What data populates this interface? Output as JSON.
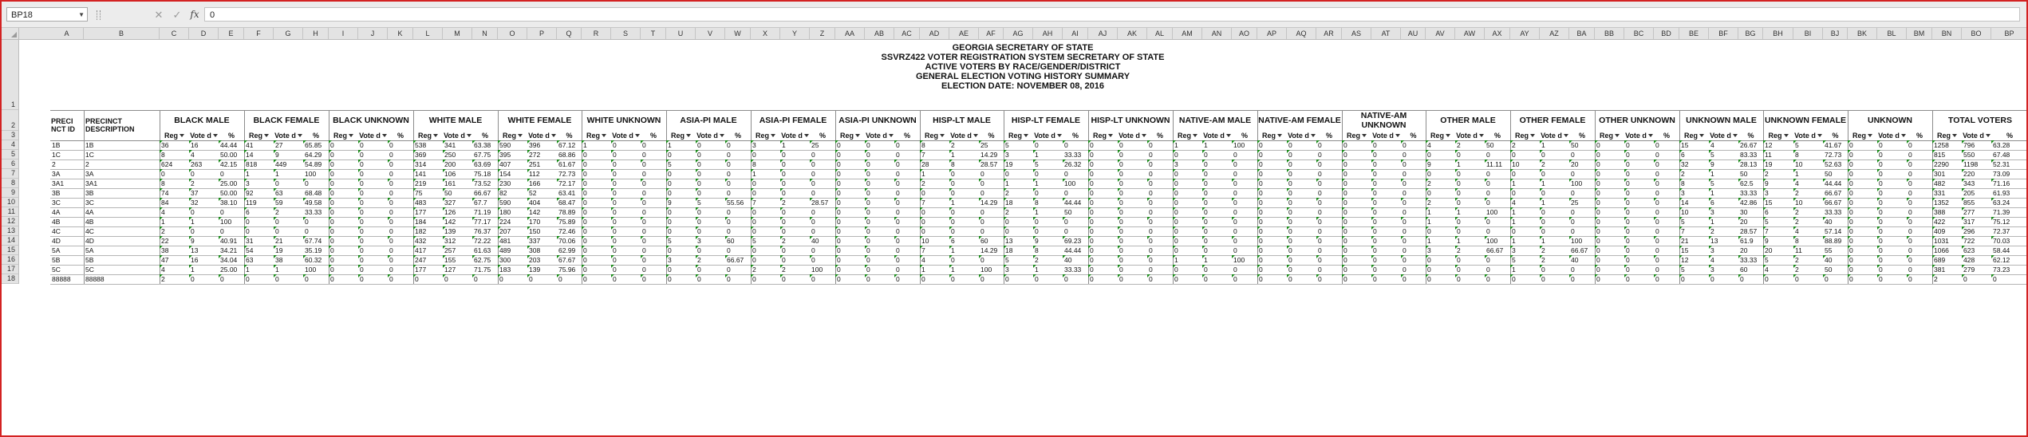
{
  "formula_bar": {
    "name_box": "BP18",
    "cancel_icon": "close-icon",
    "enter_icon": "check-icon",
    "fx_label": "fx",
    "value": "0"
  },
  "columns": [
    "A",
    "B",
    "C",
    "D",
    "E",
    "F",
    "G",
    "H",
    "I",
    "J",
    "K",
    "L",
    "M",
    "N",
    "O",
    "P",
    "Q",
    "R",
    "S",
    "T",
    "U",
    "V",
    "W",
    "X",
    "Y",
    "Z",
    "AA",
    "AB",
    "AC",
    "AD",
    "AE",
    "AF",
    "AG",
    "AH",
    "AI",
    "AJ",
    "AK",
    "AL",
    "AM",
    "AN",
    "AO",
    "AP",
    "AQ",
    "AR",
    "AS",
    "AT",
    "AU",
    "AV",
    "AW",
    "AX",
    "AY",
    "AZ",
    "BA",
    "BB",
    "BC",
    "BD",
    "BE",
    "BF",
    "BG",
    "BH",
    "BI",
    "BJ",
    "BK",
    "BL",
    "BM",
    "BN",
    "BO",
    "BP"
  ],
  "rows": [
    "1",
    "2",
    "3",
    "4",
    "5",
    "6",
    "7",
    "8",
    "9",
    "10",
    "11",
    "12",
    "13",
    "14",
    "15",
    "16",
    "17",
    "18"
  ],
  "report_title": [
    "GEORGIA SECRETARY OF STATE",
    "SSVRZ422 VOTER REGISTRATION SYSTEM SECRETARY OF STATE",
    "ACTIVE VOTERS BY RACE/GENDER/DISTRICT",
    "GENERAL ELECTION VOTING HISTORY SUMMARY",
    "ELECTION DATE: NOVEMBER 08, 2016"
  ],
  "header": {
    "precinct_id": "PRECI NCT ID",
    "precinct_desc": "PRECINCT DESCRIPTION",
    "groups": [
      "BLACK MALE",
      "BLACK FEMALE",
      "BLACK UNKNOWN",
      "WHITE MALE",
      "WHITE FEMALE",
      "WHITE UNKNOWN",
      "ASIA-PI MALE",
      "ASIA-PI FEMALE",
      "ASIA-PI UNKNOWN",
      "HISP-LT MALE",
      "HISP-LT FEMALE",
      "HISP-LT UNKNOWN",
      "NATIVE-AM MALE",
      "NATIVE-AM FEMALE",
      "NATIVE-AM UNKNOWN",
      "OTHER MALE",
      "OTHER FEMALE",
      "OTHER UNKNOWN",
      "UNKNOWN MALE",
      "UNKNOWN FEMALE",
      "UNKNOWN",
      "TOTAL VOTERS"
    ],
    "sub": [
      "Reg",
      "Vote d",
      "%"
    ]
  },
  "data_rows": [
    {
      "id": "1B",
      "desc": "1B",
      "v": [
        "36",
        "16",
        "44.44",
        "41",
        "27",
        "65.85",
        "0",
        "0",
        "0",
        "538",
        "341",
        "63.38",
        "590",
        "396",
        "67.12",
        "1",
        "0",
        "0",
        "1",
        "0",
        "0",
        "3",
        "1",
        "25",
        "0",
        "0",
        "0",
        "8",
        "2",
        "25",
        "5",
        "0",
        "0",
        "0",
        "0",
        "0",
        "1",
        "1",
        "100",
        "0",
        "0",
        "0",
        "0",
        "0",
        "0",
        "4",
        "2",
        "50",
        "2",
        "1",
        "50",
        "0",
        "0",
        "0",
        "15",
        "4",
        "26.67",
        "12",
        "5",
        "41.67",
        "0",
        "0",
        "0",
        "1258",
        "796",
        "63.28"
      ]
    },
    {
      "id": "1C",
      "desc": "1C",
      "v": [
        "8",
        "4",
        "50.00",
        "14",
        "9",
        "64.29",
        "0",
        "0",
        "0",
        "369",
        "250",
        "67.75",
        "395",
        "272",
        "68.86",
        "0",
        "0",
        "0",
        "0",
        "0",
        "0",
        "0",
        "0",
        "0",
        "0",
        "0",
        "0",
        "7",
        "1",
        "14.29",
        "3",
        "1",
        "33.33",
        "0",
        "0",
        "0",
        "0",
        "0",
        "0",
        "0",
        "0",
        "0",
        "0",
        "0",
        "0",
        "0",
        "0",
        "0",
        "0",
        "0",
        "0",
        "0",
        "0",
        "0",
        "6",
        "5",
        "83.33",
        "11",
        "8",
        "72.73",
        "0",
        "0",
        "0",
        "815",
        "550",
        "67.48"
      ]
    },
    {
      "id": "2",
      "desc": "2",
      "v": [
        "624",
        "263",
        "42.15",
        "818",
        "449",
        "54.89",
        "0",
        "0",
        "0",
        "314",
        "200",
        "63.69",
        "407",
        "251",
        "61.67",
        "0",
        "0",
        "0",
        "5",
        "0",
        "0",
        "8",
        "0",
        "0",
        "0",
        "0",
        "0",
        "28",
        "8",
        "28.57",
        "19",
        "5",
        "26.32",
        "0",
        "0",
        "0",
        "3",
        "0",
        "0",
        "0",
        "0",
        "0",
        "0",
        "0",
        "0",
        "9",
        "1",
        "11.11",
        "10",
        "2",
        "20",
        "0",
        "0",
        "0",
        "32",
        "9",
        "28.13",
        "19",
        "10",
        "52.63",
        "0",
        "0",
        "0",
        "2290",
        "1198",
        "52.31"
      ]
    },
    {
      "id": "3A",
      "desc": "3A",
      "v": [
        "0",
        "0",
        "0",
        "1",
        "1",
        "100",
        "0",
        "0",
        "0",
        "141",
        "106",
        "75.18",
        "154",
        "112",
        "72.73",
        "0",
        "0",
        "0",
        "0",
        "0",
        "0",
        "1",
        "0",
        "0",
        "0",
        "0",
        "0",
        "1",
        "0",
        "0",
        "0",
        "0",
        "0",
        "0",
        "0",
        "0",
        "0",
        "0",
        "0",
        "0",
        "0",
        "0",
        "0",
        "0",
        "0",
        "0",
        "0",
        "0",
        "0",
        "0",
        "0",
        "0",
        "0",
        "0",
        "2",
        "1",
        "50",
        "2",
        "1",
        "50",
        "0",
        "0",
        "0",
        "301",
        "220",
        "73.09"
      ]
    },
    {
      "id": "3A1",
      "desc": "3A1",
      "v": [
        "8",
        "2",
        "25.00",
        "3",
        "0",
        "0",
        "0",
        "0",
        "0",
        "219",
        "161",
        "73.52",
        "230",
        "166",
        "72.17",
        "0",
        "0",
        "0",
        "0",
        "0",
        "0",
        "0",
        "0",
        "0",
        "0",
        "0",
        "0",
        "2",
        "0",
        "0",
        "1",
        "1",
        "100",
        "0",
        "0",
        "0",
        "0",
        "0",
        "0",
        "0",
        "0",
        "0",
        "0",
        "0",
        "0",
        "2",
        "0",
        "0",
        "1",
        "1",
        "100",
        "0",
        "0",
        "0",
        "8",
        "5",
        "62.5",
        "9",
        "4",
        "44.44",
        "0",
        "0",
        "0",
        "482",
        "343",
        "71.16"
      ]
    },
    {
      "id": "3B",
      "desc": "3B",
      "v": [
        "74",
        "37",
        "50.00",
        "92",
        "63",
        "68.48",
        "0",
        "0",
        "0",
        "75",
        "50",
        "66.67",
        "82",
        "52",
        "63.41",
        "0",
        "0",
        "0",
        "0",
        "0",
        "0",
        "0",
        "0",
        "0",
        "0",
        "0",
        "0",
        "0",
        "0",
        "0",
        "2",
        "0",
        "0",
        "0",
        "0",
        "0",
        "0",
        "0",
        "0",
        "0",
        "0",
        "0",
        "0",
        "0",
        "0",
        "0",
        "0",
        "0",
        "0",
        "0",
        "0",
        "0",
        "0",
        "0",
        "3",
        "1",
        "33.33",
        "3",
        "2",
        "66.67",
        "0",
        "0",
        "0",
        "331",
        "205",
        "61.93"
      ]
    },
    {
      "id": "3C",
      "desc": "3C",
      "v": [
        "84",
        "32",
        "38.10",
        "119",
        "59",
        "49.58",
        "0",
        "0",
        "0",
        "483",
        "327",
        "67.7",
        "590",
        "404",
        "68.47",
        "0",
        "0",
        "0",
        "9",
        "5",
        "55.56",
        "7",
        "2",
        "28.57",
        "0",
        "0",
        "0",
        "7",
        "1",
        "14.29",
        "18",
        "8",
        "44.44",
        "0",
        "0",
        "0",
        "0",
        "0",
        "0",
        "0",
        "0",
        "0",
        "0",
        "0",
        "0",
        "2",
        "0",
        "0",
        "4",
        "1",
        "25",
        "0",
        "0",
        "0",
        "14",
        "6",
        "42.86",
        "15",
        "10",
        "66.67",
        "0",
        "0",
        "0",
        "1352",
        "855",
        "63.24"
      ]
    },
    {
      "id": "4A",
      "desc": "4A",
      "v": [
        "4",
        "0",
        "0",
        "6",
        "2",
        "33.33",
        "0",
        "0",
        "0",
        "177",
        "126",
        "71.19",
        "180",
        "142",
        "78.89",
        "0",
        "0",
        "0",
        "0",
        "0",
        "0",
        "0",
        "0",
        "0",
        "0",
        "0",
        "0",
        "0",
        "0",
        "0",
        "2",
        "1",
        "50",
        "0",
        "0",
        "0",
        "0",
        "0",
        "0",
        "0",
        "0",
        "0",
        "0",
        "0",
        "0",
        "1",
        "1",
        "100",
        "1",
        "0",
        "0",
        "0",
        "0",
        "0",
        "10",
        "3",
        "30",
        "6",
        "2",
        "33.33",
        "0",
        "0",
        "0",
        "388",
        "277",
        "71.39"
      ]
    },
    {
      "id": "4B",
      "desc": "4B",
      "v": [
        "1",
        "1",
        "100",
        "0",
        "0",
        "0",
        "0",
        "0",
        "0",
        "184",
        "142",
        "77.17",
        "224",
        "170",
        "75.89",
        "0",
        "0",
        "0",
        "0",
        "0",
        "0",
        "0",
        "0",
        "0",
        "0",
        "0",
        "0",
        "0",
        "0",
        "0",
        "0",
        "0",
        "0",
        "0",
        "0",
        "0",
        "0",
        "0",
        "0",
        "0",
        "0",
        "0",
        "0",
        "0",
        "0",
        "1",
        "0",
        "0",
        "1",
        "0",
        "0",
        "0",
        "0",
        "0",
        "5",
        "1",
        "20",
        "5",
        "2",
        "40",
        "0",
        "0",
        "0",
        "422",
        "317",
        "75.12"
      ]
    },
    {
      "id": "4C",
      "desc": "4C",
      "v": [
        "2",
        "0",
        "0",
        "0",
        "0",
        "0",
        "0",
        "0",
        "0",
        "182",
        "139",
        "76.37",
        "207",
        "150",
        "72.46",
        "0",
        "0",
        "0",
        "0",
        "0",
        "0",
        "0",
        "0",
        "0",
        "0",
        "0",
        "0",
        "0",
        "0",
        "0",
        "0",
        "0",
        "0",
        "0",
        "0",
        "0",
        "0",
        "0",
        "0",
        "0",
        "0",
        "0",
        "0",
        "0",
        "0",
        "0",
        "0",
        "0",
        "0",
        "0",
        "0",
        "0",
        "0",
        "0",
        "7",
        "2",
        "28.57",
        "7",
        "4",
        "57.14",
        "0",
        "0",
        "0",
        "409",
        "296",
        "72.37"
      ]
    },
    {
      "id": "4D",
      "desc": "4D",
      "v": [
        "22",
        "9",
        "40.91",
        "31",
        "21",
        "67.74",
        "0",
        "0",
        "0",
        "432",
        "312",
        "72.22",
        "481",
        "337",
        "70.06",
        "0",
        "0",
        "0",
        "5",
        "3",
        "60",
        "5",
        "2",
        "40",
        "0",
        "0",
        "0",
        "10",
        "6",
        "60",
        "13",
        "9",
        "69.23",
        "0",
        "0",
        "0",
        "0",
        "0",
        "0",
        "0",
        "0",
        "0",
        "0",
        "0",
        "0",
        "1",
        "1",
        "100",
        "1",
        "1",
        "100",
        "0",
        "0",
        "0",
        "21",
        "13",
        "61.9",
        "9",
        "8",
        "88.89",
        "0",
        "0",
        "0",
        "1031",
        "722",
        "70.03"
      ]
    },
    {
      "id": "5A",
      "desc": "5A",
      "v": [
        "38",
        "13",
        "34.21",
        "54",
        "19",
        "35.19",
        "0",
        "0",
        "0",
        "417",
        "257",
        "61.63",
        "489",
        "308",
        "62.99",
        "0",
        "0",
        "0",
        "0",
        "0",
        "0",
        "0",
        "0",
        "0",
        "0",
        "0",
        "0",
        "7",
        "1",
        "14.29",
        "18",
        "8",
        "44.44",
        "0",
        "0",
        "0",
        "0",
        "0",
        "0",
        "0",
        "0",
        "0",
        "0",
        "0",
        "0",
        "3",
        "2",
        "66.67",
        "3",
        "2",
        "66.67",
        "0",
        "0",
        "0",
        "15",
        "3",
        "20",
        "20",
        "11",
        "55",
        "0",
        "0",
        "0",
        "1066",
        "623",
        "58.44"
      ]
    },
    {
      "id": "5B",
      "desc": "5B",
      "v": [
        "47",
        "16",
        "34.04",
        "63",
        "38",
        "60.32",
        "0",
        "0",
        "0",
        "247",
        "155",
        "62.75",
        "300",
        "203",
        "67.67",
        "0",
        "0",
        "0",
        "3",
        "2",
        "66.67",
        "0",
        "0",
        "0",
        "0",
        "0",
        "0",
        "4",
        "0",
        "0",
        "5",
        "2",
        "40",
        "0",
        "0",
        "0",
        "1",
        "1",
        "100",
        "0",
        "0",
        "0",
        "0",
        "0",
        "0",
        "0",
        "0",
        "0",
        "5",
        "2",
        "40",
        "0",
        "0",
        "0",
        "12",
        "4",
        "33.33",
        "5",
        "2",
        "40",
        "0",
        "0",
        "0",
        "689",
        "428",
        "62.12"
      ]
    },
    {
      "id": "5C",
      "desc": "5C",
      "v": [
        "4",
        "1",
        "25.00",
        "1",
        "1",
        "100",
        "0",
        "0",
        "0",
        "177",
        "127",
        "71.75",
        "183",
        "139",
        "75.96",
        "0",
        "0",
        "0",
        "0",
        "0",
        "0",
        "2",
        "2",
        "100",
        "0",
        "0",
        "0",
        "1",
        "1",
        "100",
        "3",
        "1",
        "33.33",
        "0",
        "0",
        "0",
        "0",
        "0",
        "0",
        "0",
        "0",
        "0",
        "0",
        "0",
        "0",
        "0",
        "0",
        "0",
        "1",
        "0",
        "0",
        "0",
        "0",
        "0",
        "5",
        "3",
        "60",
        "4",
        "2",
        "50",
        "0",
        "0",
        "0",
        "381",
        "279",
        "73.23"
      ]
    },
    {
      "id": "88888",
      "desc": "88888",
      "v": [
        "2",
        "0",
        "0",
        "0",
        "0",
        "0",
        "0",
        "0",
        "0",
        "0",
        "0",
        "0",
        "0",
        "0",
        "0",
        "0",
        "0",
        "0",
        "0",
        "0",
        "0",
        "0",
        "0",
        "0",
        "0",
        "0",
        "0",
        "0",
        "0",
        "0",
        "0",
        "0",
        "0",
        "0",
        "0",
        "0",
        "0",
        "0",
        "0",
        "0",
        "0",
        "0",
        "0",
        "0",
        "0",
        "0",
        "0",
        "0",
        "0",
        "0",
        "0",
        "0",
        "0",
        "0",
        "0",
        "0",
        "0",
        "0",
        "0",
        "0",
        "0",
        "0",
        "0",
        "2",
        "0",
        "0"
      ]
    }
  ]
}
